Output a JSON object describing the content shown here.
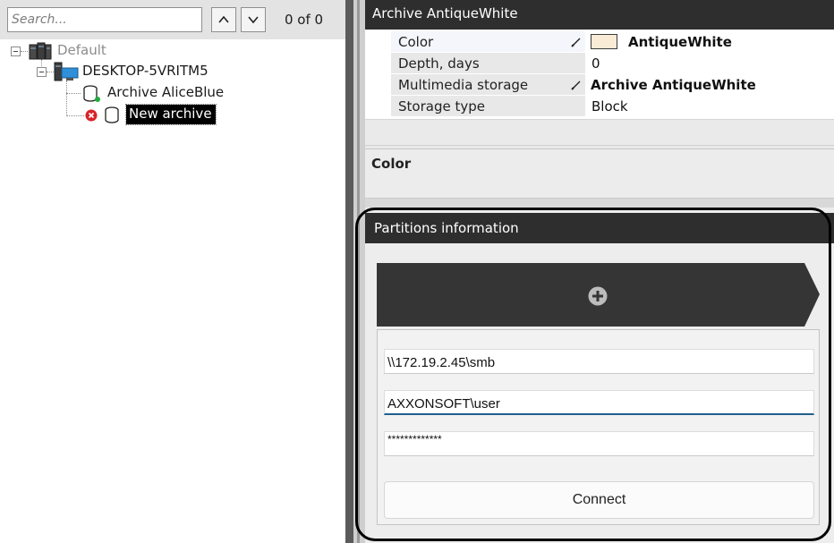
{
  "left_panel": {
    "search": {
      "placeholder": "Search...",
      "value": ""
    },
    "match_count": "0 of 0",
    "tree": {
      "root": {
        "label": "Default"
      },
      "server": {
        "label": "DESKTOP-5VRITM5"
      },
      "archives": [
        {
          "label": "Archive AliceBlue"
        },
        {
          "label": "New archive"
        }
      ]
    }
  },
  "properties": {
    "header": "Archive AntiqueWhite",
    "rows": [
      {
        "name": "Color",
        "value": "AntiqueWhite",
        "swatch": "#FAEBD7"
      },
      {
        "name": "Depth, days",
        "value": "0"
      },
      {
        "name": "Multimedia storage",
        "value": "Archive AntiqueWhite"
      },
      {
        "name": "Storage type",
        "value": "Block"
      }
    ],
    "description_title": "Color"
  },
  "partitions": {
    "header": "Partitions information",
    "address": "\\\\172.19.2.45\\smb",
    "user": "AXXONSOFT\\user",
    "password": "*************",
    "connect_label": "Connect"
  },
  "colors": {
    "panel_header": "#2e2e2e",
    "selection": "#000000",
    "focus_underline": "#1f5f8e",
    "error_badge": "#d9232a"
  }
}
